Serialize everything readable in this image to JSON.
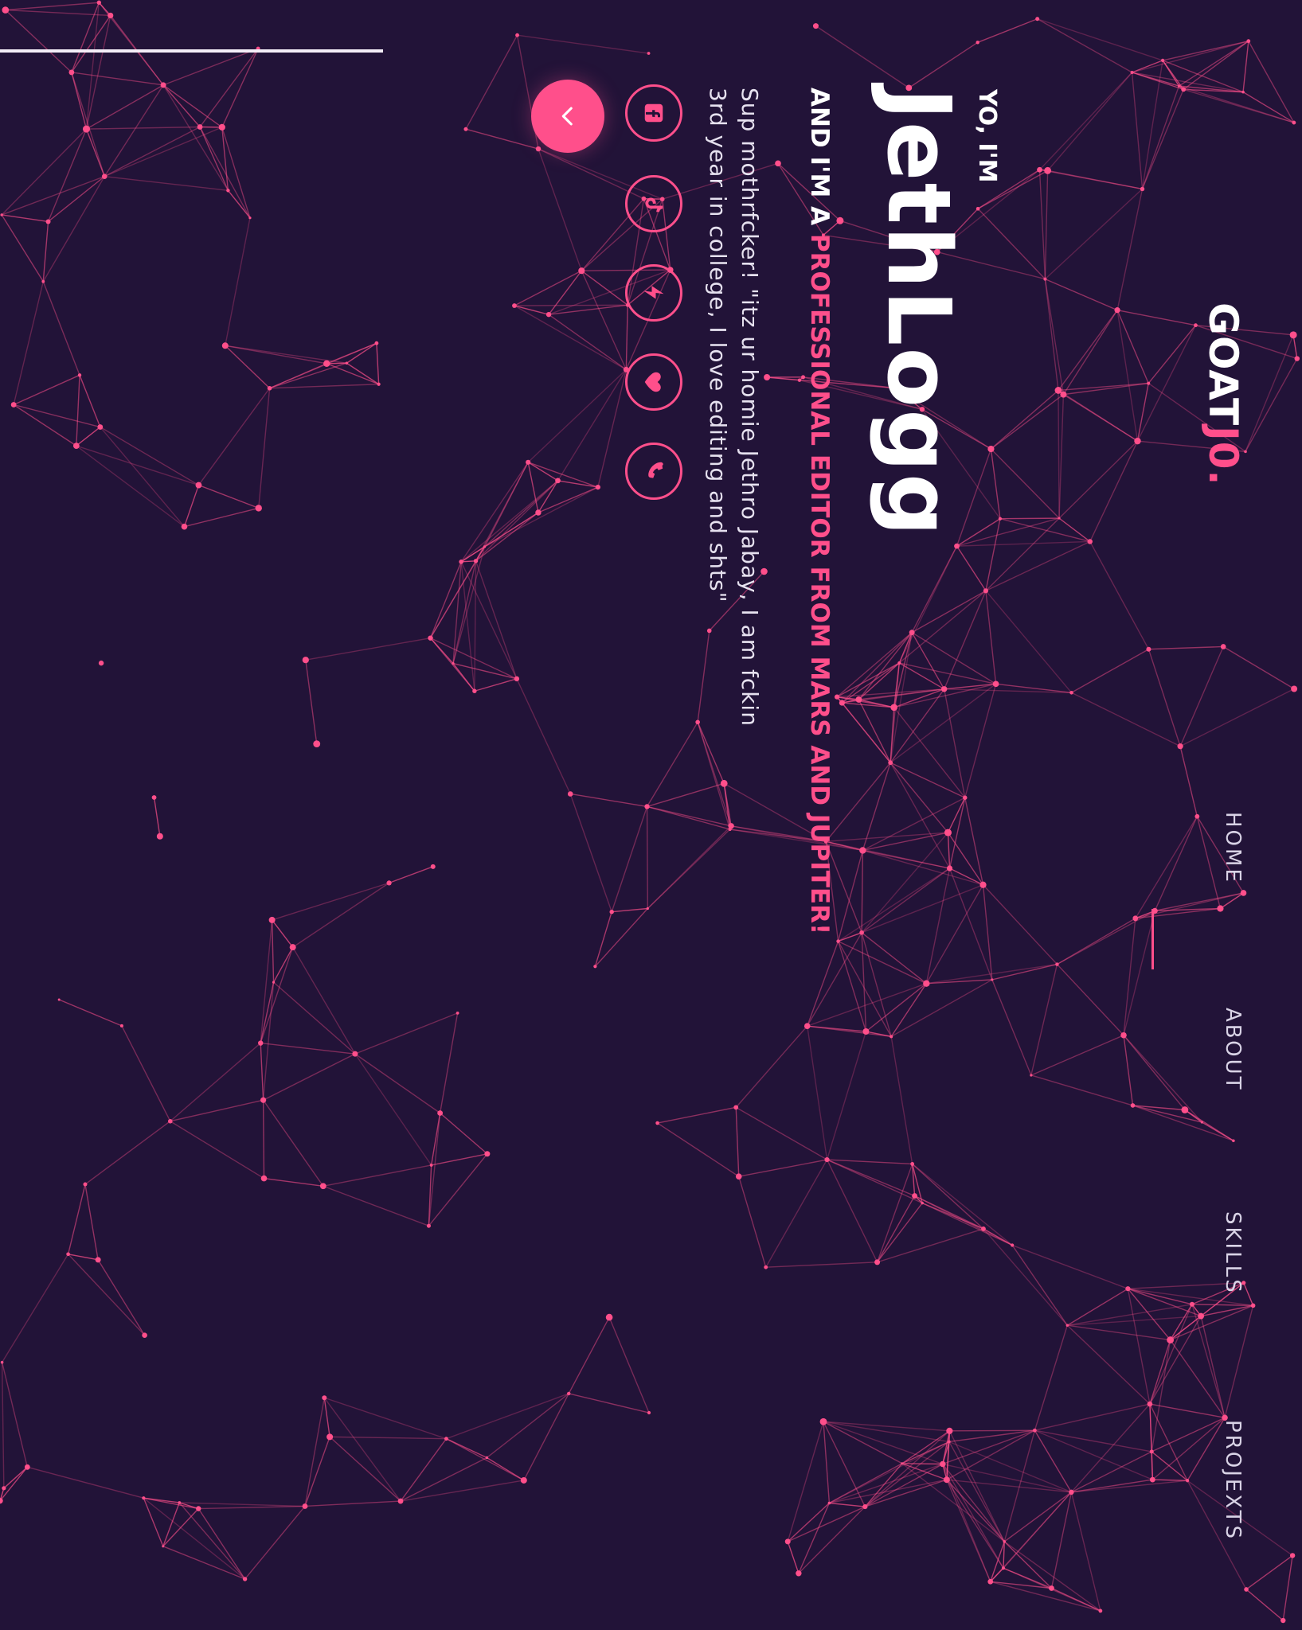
{
  "brand": {
    "text": "GOAT",
    "accent_text": "J0.",
    "accent_color": "#ff4f8b"
  },
  "nav": {
    "items": [
      {
        "label": "HOME",
        "active": true
      },
      {
        "label": "ABOUT",
        "active": false
      },
      {
        "label": "SKILLS",
        "active": false
      },
      {
        "label": "PROJEXTS",
        "active": false
      }
    ]
  },
  "hero": {
    "greeting": "YO, I'M",
    "name": "JethLogg",
    "tagline_prefix": "AND I'M A ",
    "tagline_highlight": "PROFESSIONAL EDITOR FROM MARS AND JUPITER!",
    "bio": "Sup mothrfcker! \"itz ur homie Jethro Jabay, I am fckin 3rd year in college, I love editing and shts\""
  },
  "socials": [
    {
      "name": "facebook",
      "icon": "facebook-icon"
    },
    {
      "name": "tiktok",
      "icon": "tiktok-icon"
    },
    {
      "name": "lightning",
      "icon": "lightning-icon"
    },
    {
      "name": "heart",
      "icon": "heart-icon"
    },
    {
      "name": "phone",
      "icon": "phone-icon"
    }
  ],
  "cta": {
    "icon": "chevron-down-icon"
  },
  "colors": {
    "background": "#221338",
    "accent": "#ff4f8b",
    "text": "#ffffff"
  }
}
